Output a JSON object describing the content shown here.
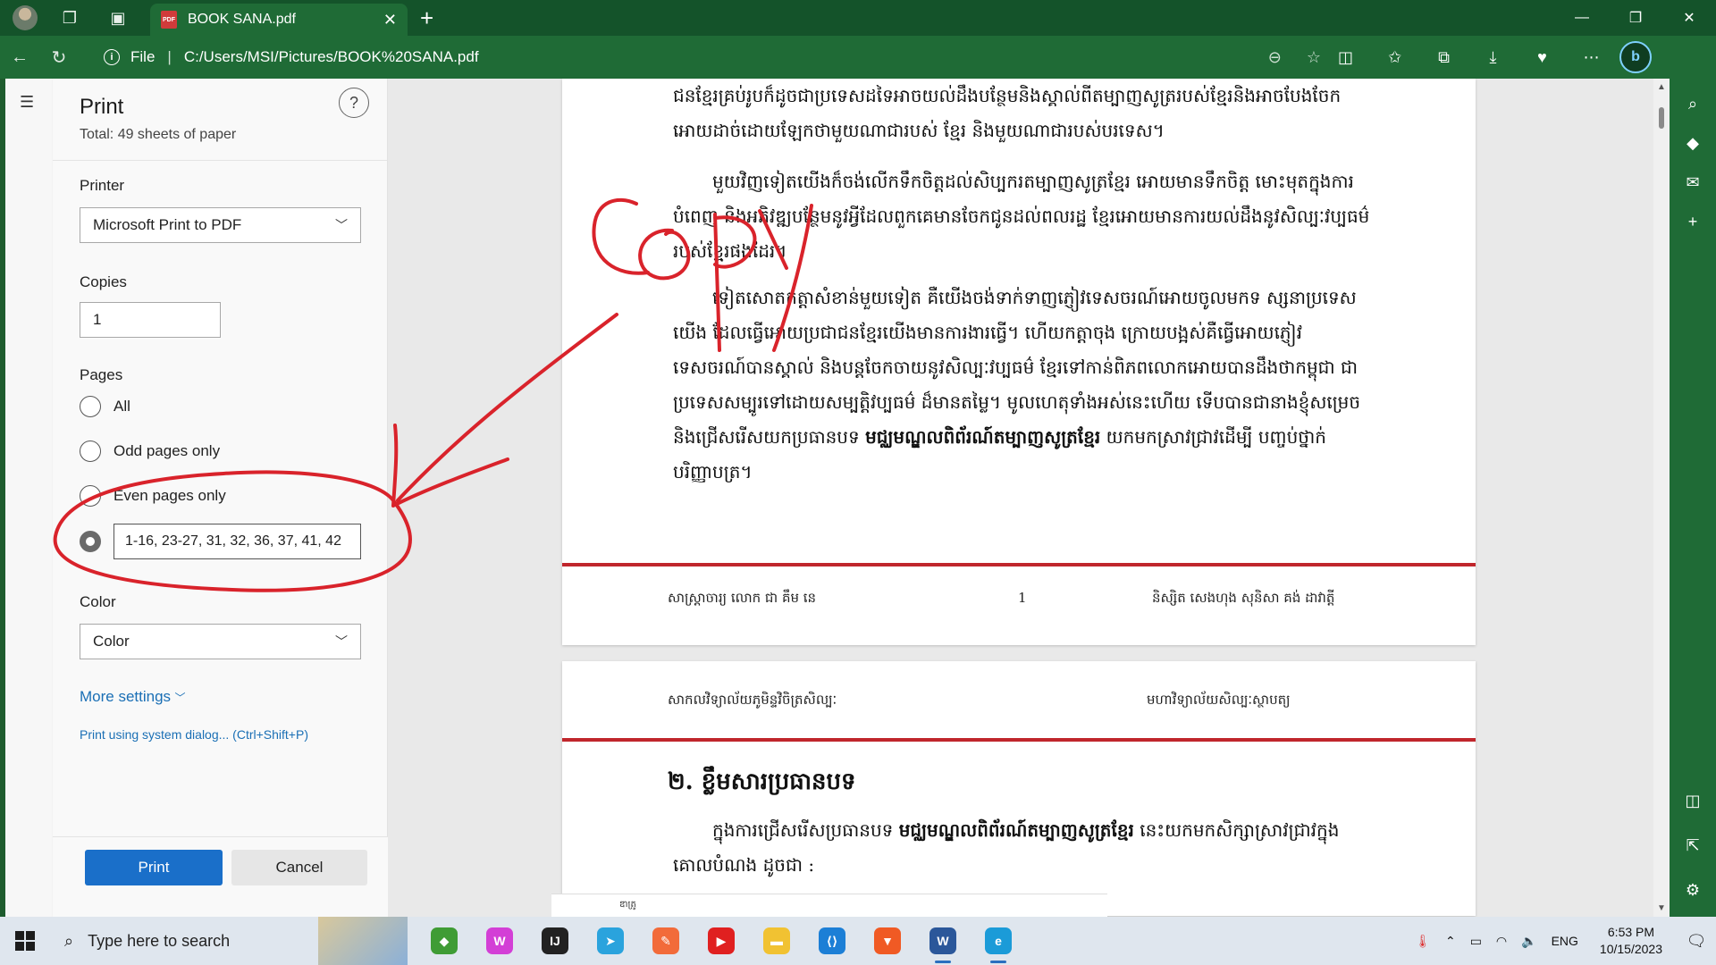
{
  "browser": {
    "tab_title": "BOOK SANA.pdf",
    "tab_icon": "pdf-icon",
    "url_scheme": "File",
    "url_path": "C:/Users/MSI/Pictures/BOOK%20SANA.pdf",
    "accent": "#14532a"
  },
  "print_panel": {
    "title": "Print",
    "total": "Total: 49 sheets of paper",
    "help": "?",
    "printer_label": "Printer",
    "printer_value": "Microsoft Print to PDF",
    "copies_label": "Copies",
    "copies_value": "1",
    "pages_label": "Pages",
    "pages_options": [
      "All",
      "Odd pages only",
      "Even pages only"
    ],
    "pages_custom_value": "1-16, 23-27, 31, 32, 36, 37, 41, 42",
    "color_label": "Color",
    "color_value": "Color",
    "more_settings": "More settings",
    "system_dialog": "Print using system dialog... (Ctrl+Shift+P)",
    "print_button": "Print",
    "cancel_button": "Cancel",
    "primary_color": "#1a6fc9"
  },
  "pdf": {
    "page1": {
      "para_a": "ជនខ្មែរគ្រប់រូបក៏ដូចជាប្រទេសដទៃអាចយល់ដឹងបន្ថែមនិងស្គាល់ពីតម្បាញសូត្ររបស់ខ្មែរនិងអាចបែងចែកអោយដាច់ដោយឡែកថាមួយណាជារបស់ ខ្មែរ និងមួយណាជារបស់បរទេស។",
      "para_b": "មួយវិញទៀតយើងក៏ចង់លើកទឹកចិត្តដល់សិប្បករតម្បាញសូត្រខ្មែរ អោយមានទឹកចិត្ត មោះមុតក្នុងការបំពេញ និងអភិវឌ្ឍបន្ថែមនូវអ្វីដែលពួកគេមានចែកជូនដល់ពលរដ្ឋ ខ្មែរអោយមានការយល់ដឹងនូវសិល្បៈវប្បធម៌របស់ខ្មែរផងដែរ។",
      "para_c_pre": "ទៀតសោតកត្តាសំខាន់មួយទៀត គឺយើងចង់ទាក់ទាញភ្ញៀវទេសចរណ៍អោយចូលមកទ ស្សនាប្រទេសយើង ដែលធ្វើអោយប្រជាជនខ្មែរយើងមានការងារធ្វើ។ ហើយកត្តាចុង ក្រោយបង្អស់គឺធ្វើអោយភ្ញៀវទេសចរណ៍បានស្គាល់ និងបន្តចែកចាយនូវសិល្បៈវប្បធម៌ ខ្មែរទៅកាន់ពិភពលោកអោយបានដឹងថាកម្ពុជា ជាប្រទេសសម្បូរទៅដោយសម្បត្តិវប្បធម៌ ដ៏មានតម្លៃ។ មូលហេតុទាំងអស់នេះហើយ ទើបបានជានាងខ្ញុំសម្រេចនិងជ្រើសរើសយកប្រធានបទ ",
      "para_c_bold": "មជ្ឈមណ្ឌលពិព័រណ៍តម្បាញសូត្រខ្មែរ",
      "para_c_post": " យកមកស្រាវជ្រាវដើម្បី បញ្ចប់ថ្នាក់បរិញ្ញាបត្រ។",
      "footer_left": "សាស្ត្រាចារ្យ លោក ជា គឹម នេ",
      "footer_num": "1",
      "footer_right": "និស្សិត សេងហុង សុនិសា   គង់ ដាវាត្តី"
    },
    "page2": {
      "header_left": "សាកលវិទ្យាល័យភូមិន្ទវិចិត្រសិល្បៈ",
      "header_right": "មហាវិទ្យាល័យសិល្បៈស្ថាបត្យ",
      "heading": "២. ខ្លឹមសារប្រធានបទ",
      "para_pre": "ក្នុងការជ្រើសរើសប្រធានបទ ",
      "para_bold": "មជ្ឈមណ្ឌលពិព័រណ៍តម្បាញសូត្រខ្មែរ",
      "para_post": " នេះយកមកសិក្សាស្រាវជ្រាវក្នុងគោលបំណង ដូចជា :"
    },
    "page3_stub": "ឌាត្រូ"
  },
  "annotation": {
    "handwritten_word": "COPY",
    "color": "#d9232b"
  },
  "taskbar": {
    "search_placeholder": "Type here to search",
    "tray_lang": "ENG",
    "time": "6:53 PM",
    "date": "10/15/2023",
    "apps": [
      {
        "name": "mongodb-icon",
        "color": "#3f9c35",
        "glyph": "◆"
      },
      {
        "name": "webstorm-icon",
        "color": "#d33fd6",
        "glyph": "W"
      },
      {
        "name": "jetbrains-icon",
        "color": "#222222",
        "glyph": "IJ"
      },
      {
        "name": "telegram-icon",
        "color": "#2aa3dd",
        "glyph": "➤"
      },
      {
        "name": "postman-icon",
        "color": "#f26b3a",
        "glyph": "✎"
      },
      {
        "name": "youtube-icon",
        "color": "#e02020",
        "glyph": "▶"
      },
      {
        "name": "file-explorer-icon",
        "color": "#f1c232",
        "glyph": "▬"
      },
      {
        "name": "vscode-icon",
        "color": "#1c7fd6",
        "glyph": "⟨⟩"
      },
      {
        "name": "brave-icon",
        "color": "#f05a24",
        "glyph": "▼"
      },
      {
        "name": "word-icon",
        "color": "#2b579a",
        "glyph": "W"
      },
      {
        "name": "edge-icon",
        "color": "#1b9bd8",
        "glyph": "e"
      }
    ]
  }
}
